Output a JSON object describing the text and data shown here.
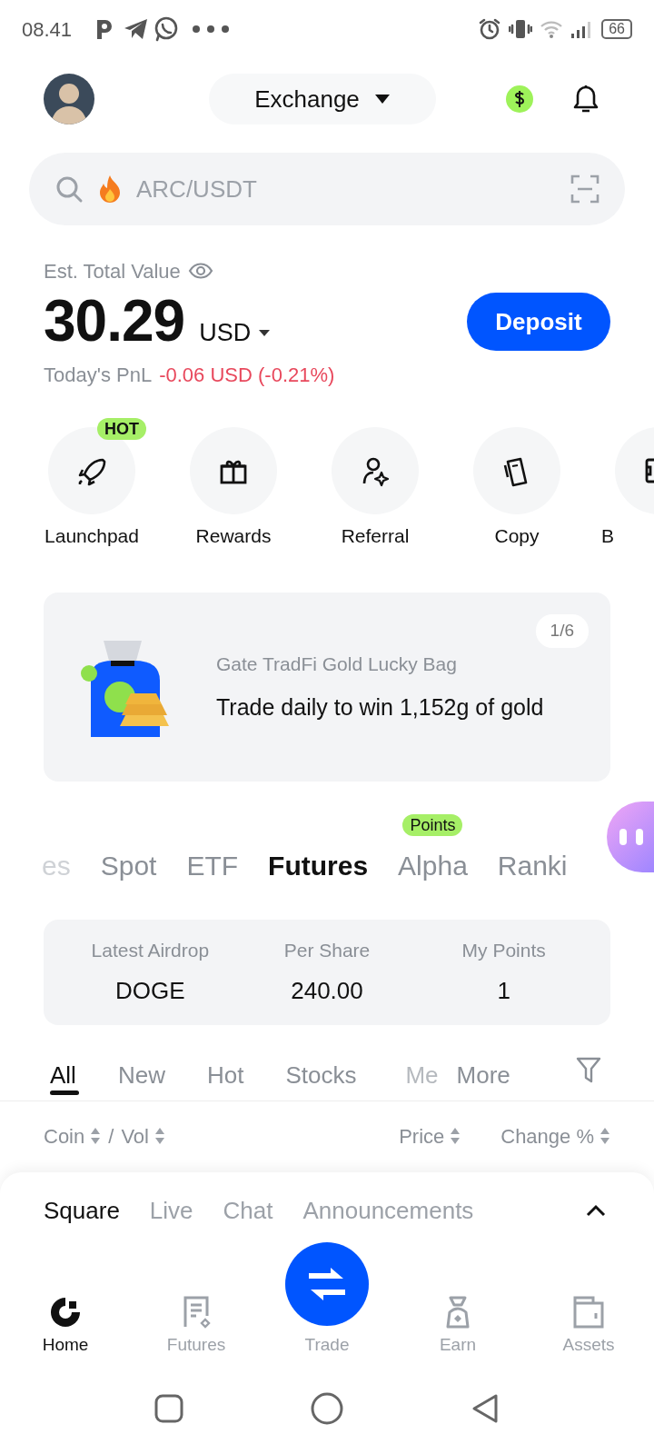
{
  "status_bar": {
    "time": "08.41",
    "battery": "66"
  },
  "header": {
    "switcher": "Exchange"
  },
  "search": {
    "placeholder": "ARC/USDT"
  },
  "balance": {
    "label": "Est. Total Value",
    "value": "30.29",
    "currency": "USD",
    "pnl_label": "Today's PnL",
    "pnl_value": "-0.06 USD (-0.21%)"
  },
  "deposit_button": "Deposit",
  "shortcuts": [
    {
      "label": "Launchpad",
      "kind": "rocket",
      "badge": "HOT"
    },
    {
      "label": "Rewards",
      "kind": "gift"
    },
    {
      "label": "Referral",
      "kind": "referral"
    },
    {
      "label": "Copy",
      "kind": "copy"
    },
    {
      "label": "B",
      "kind": "safe"
    }
  ],
  "banner": {
    "pager": "1/6",
    "title": "Gate TradFi Gold Lucky Bag",
    "text": "Trade daily to win 1,152g of gold"
  },
  "market_tabs": [
    {
      "label": "es",
      "selected": false
    },
    {
      "label": "Spot",
      "selected": false
    },
    {
      "label": "ETF",
      "selected": false
    },
    {
      "label": "Futures",
      "selected": true
    },
    {
      "label": "Alpha",
      "selected": false,
      "badge": "Points"
    },
    {
      "label": "Ranki",
      "selected": false
    }
  ],
  "airdrop": [
    {
      "label": "Latest Airdrop",
      "value": "DOGE"
    },
    {
      "label": "Per Share",
      "value": "240.00"
    },
    {
      "label": "My Points",
      "value": "1"
    }
  ],
  "filter_tabs": [
    {
      "label": "All",
      "selected": true
    },
    {
      "label": "New",
      "selected": false
    },
    {
      "label": "Hot",
      "selected": false
    },
    {
      "label": "Stocks",
      "selected": false
    },
    {
      "label": "Me",
      "selected": false
    },
    {
      "label": "More",
      "selected": false
    }
  ],
  "list_header": {
    "coin": "Coin",
    "separator": "/",
    "volume": "Vol",
    "price": "Price",
    "change": "Change %"
  },
  "sheet_tabs": [
    {
      "label": "Square",
      "selected": true
    },
    {
      "label": "Live",
      "selected": false
    },
    {
      "label": "Chat",
      "selected": false
    },
    {
      "label": "Announcements",
      "selected": false
    }
  ],
  "bottom_nav": [
    {
      "label": "Home",
      "kind": "home",
      "selected": true
    },
    {
      "label": "Futures",
      "kind": "futures",
      "selected": false
    },
    {
      "label": "Trade",
      "kind": "trade",
      "selected": false
    },
    {
      "label": "Earn",
      "kind": "earn",
      "selected": false
    },
    {
      "label": "Assets",
      "kind": "assets",
      "selected": false
    }
  ]
}
